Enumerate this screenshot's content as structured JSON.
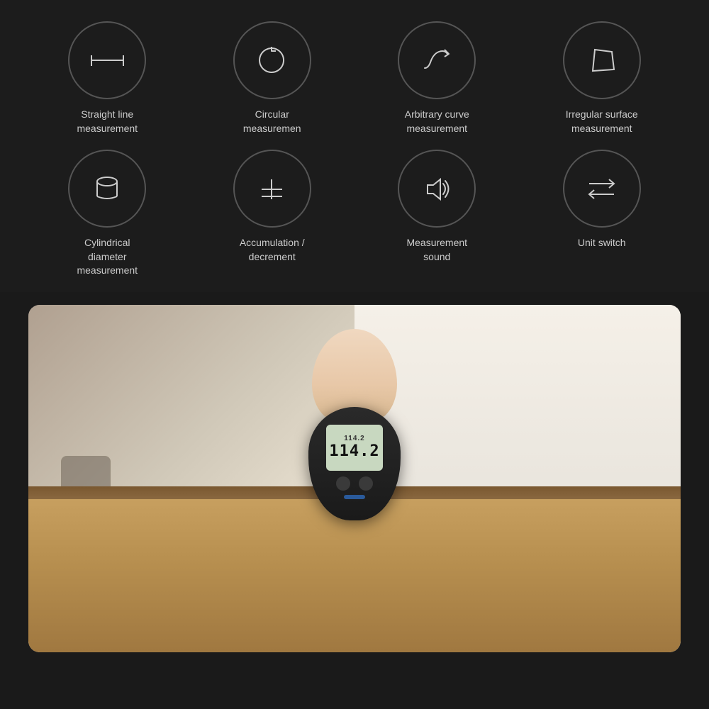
{
  "background_color": "#1c1c1c",
  "features": [
    {
      "id": "straight-line",
      "label": "Straight line\nmeasurement",
      "icon_type": "straight-line"
    },
    {
      "id": "circular",
      "label": "Circular\nmeasuremen",
      "icon_type": "circular"
    },
    {
      "id": "arbitrary-curve",
      "label": "Arbitrary curve\nmeasurement",
      "icon_type": "arbitrary-curve"
    },
    {
      "id": "irregular-surface",
      "label": "Irregular surface\nmeasurement",
      "icon_type": "irregular-surface"
    },
    {
      "id": "cylindrical",
      "label": "Cylindrical\ndiameter\nmeasurement",
      "icon_type": "cylindrical"
    },
    {
      "id": "accumulation",
      "label": "Accumulation /\ndecrement",
      "icon_type": "accumulation"
    },
    {
      "id": "sound",
      "label": "Measurement\nsound",
      "icon_type": "sound"
    },
    {
      "id": "unit-switch",
      "label": "Unit switch",
      "icon_type": "unit-switch"
    }
  ],
  "device": {
    "screen_value_small": "114.2",
    "screen_value_large": "114.2"
  }
}
